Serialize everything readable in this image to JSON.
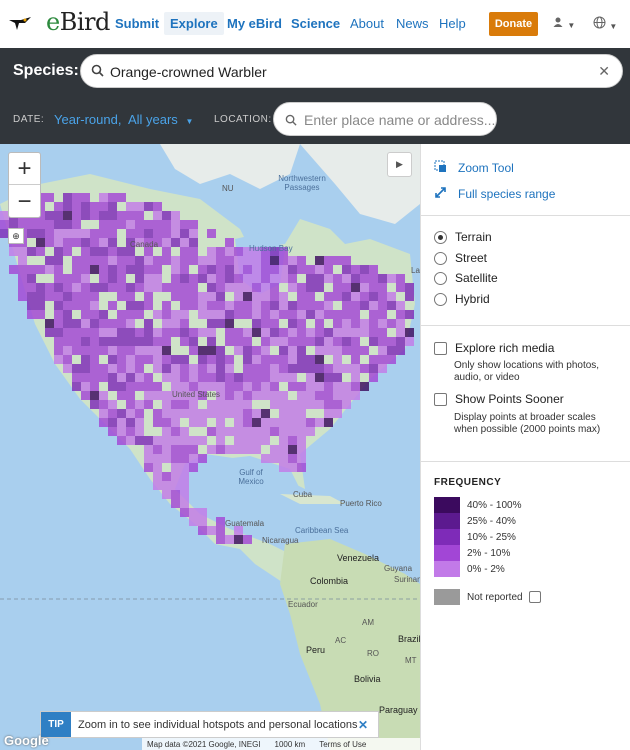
{
  "nav": {
    "brand": "eBird",
    "links": [
      "Submit",
      "Explore",
      "My eBird",
      "Science",
      "About",
      "News",
      "Help"
    ],
    "donate": "Donate",
    "user_icon": "user-icon",
    "lang_icon": "globe-icon"
  },
  "species": {
    "label": "Species:",
    "value": "Orange-crowned Warbler"
  },
  "filters": {
    "date_label": "DATE:",
    "date_value": "Year-round,  All years",
    "location_label": "LOCATION:",
    "location_placeholder": "Enter place name or address..."
  },
  "map": {
    "labels": {
      "nu": "NU",
      "northwestern_passages": "Northwestern Passages",
      "hudson_bay": "Hudson Bay",
      "canada": "Canada",
      "united_states": "United States",
      "gulf_of_mexico": "Gulf of Mexico",
      "cuba": "Cuba",
      "puerto_rico": "Puerto Rico",
      "guatemala": "Guatemala",
      "caribbean_sea": "Caribbean Sea",
      "nicaragua": "Nicaragua",
      "venezuela": "Venezuela",
      "guyana": "Guyana",
      "suriname": "Surinam",
      "colombia": "Colombia",
      "ecuador": "Ecuador",
      "am": "AM",
      "brazil": "Brazil",
      "ac": "AC",
      "peru": "Peru",
      "mt": "MT",
      "ro": "RO",
      "bolivia": "Bolivia",
      "paraguay": "Paraguay",
      "la": "La"
    },
    "tip_badge": "TIP",
    "tip_text": "Zoom in to see individual hotspots and personal locations",
    "google": "Google",
    "attribution": [
      "Map data ©2021 Google, INEGI",
      "1000 km",
      "Terms of Use"
    ]
  },
  "panel": {
    "zoom_tool": "Zoom Tool",
    "full_range": "Full species range",
    "map_types": [
      {
        "label": "Terrain",
        "selected": true
      },
      {
        "label": "Street",
        "selected": false
      },
      {
        "label": "Satellite",
        "selected": false
      },
      {
        "label": "Hybrid",
        "selected": false
      }
    ],
    "rich_media_label": "Explore rich media",
    "rich_media_sub": "Only show locations with photos, audio, or video",
    "points_label": "Show Points Sooner",
    "points_sub": "Display points at broader scales when possible (2000 points max)",
    "frequency_title": "FREQUENCY",
    "legend": [
      {
        "label": "40% - 100%",
        "color": "#3b0a5e"
      },
      {
        "label": "25% - 40%",
        "color": "#5c1a8f"
      },
      {
        "label": "10% - 25%",
        "color": "#7e2bb8"
      },
      {
        "label": "2% - 10%",
        "color": "#a246d6"
      },
      {
        "label": "0% - 2%",
        "color": "#c27ae8"
      }
    ],
    "not_reported": "Not reported"
  }
}
